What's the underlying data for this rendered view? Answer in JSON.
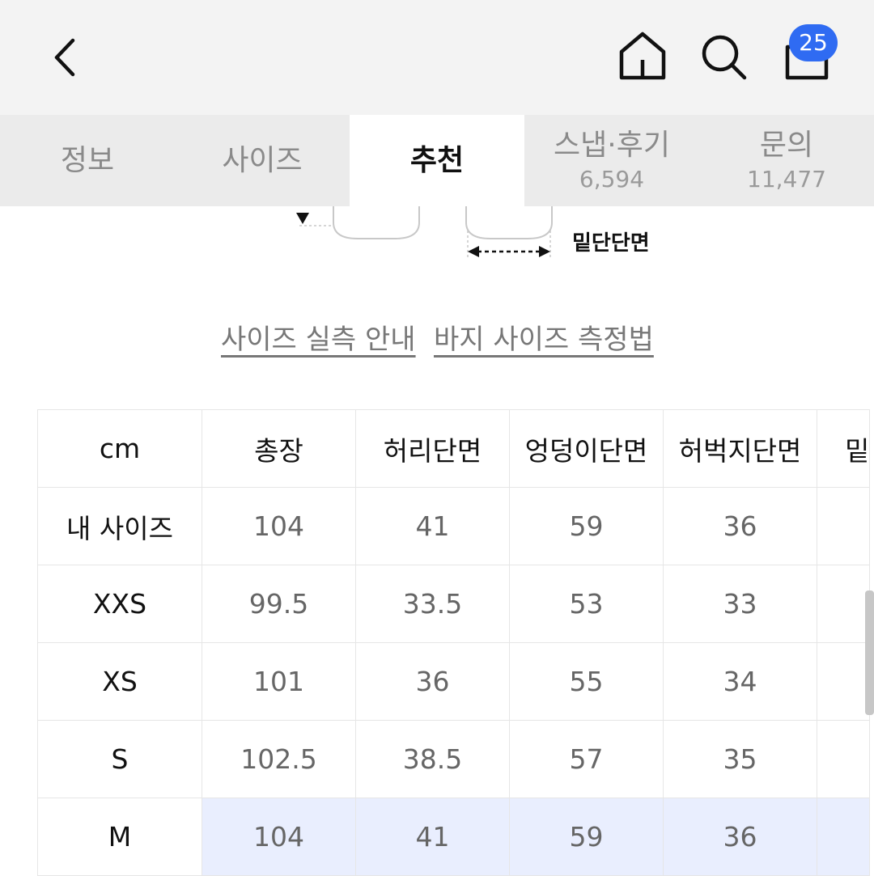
{
  "header": {
    "back_icon": "chevron-left-icon",
    "home_icon": "home-icon",
    "search_icon": "search-icon",
    "cart_icon": "cart-icon",
    "cart_badge": "25",
    "badge_color": "#2f6bf2"
  },
  "tabs": [
    {
      "label": "정보",
      "count": ""
    },
    {
      "label": "사이즈",
      "count": ""
    },
    {
      "label": "추천",
      "count": ""
    },
    {
      "label": "스냅·후기",
      "count": "6,594"
    },
    {
      "label": "문의",
      "count": "11,477"
    }
  ],
  "active_tab": "추천",
  "diagram": {
    "label": "밑단단면"
  },
  "links": {
    "size_guide": "사이즈 실측 안내",
    "measure_method": "바지 사이즈 측정법"
  },
  "size_table": {
    "headers": [
      "cm",
      "총장",
      "허리단면",
      "엉덩이단면",
      "허벅지단면",
      "밑"
    ],
    "rows": [
      {
        "label": "내 사이즈",
        "values": [
          "104",
          "41",
          "59",
          "36"
        ]
      },
      {
        "label": "XXS",
        "values": [
          "99.5",
          "33.5",
          "53",
          "33"
        ]
      },
      {
        "label": "XS",
        "values": [
          "101",
          "36",
          "55",
          "34"
        ]
      },
      {
        "label": "S",
        "values": [
          "102.5",
          "38.5",
          "57",
          "35"
        ]
      },
      {
        "label": "M",
        "values": [
          "104",
          "41",
          "59",
          "36"
        ]
      }
    ],
    "highlight_row": "M",
    "highlight_color": "#e9eefe"
  }
}
